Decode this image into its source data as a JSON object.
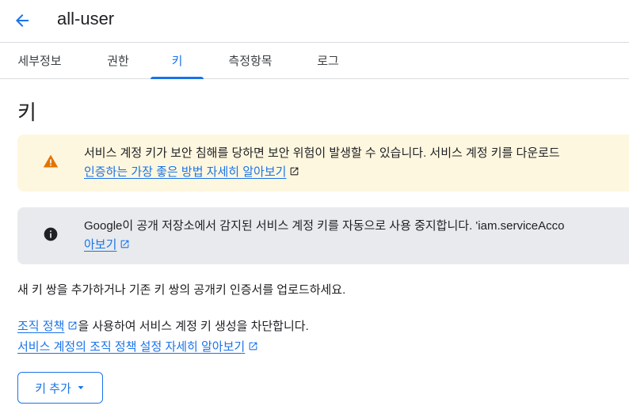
{
  "header": {
    "title": "all-user",
    "back_icon": "arrow-back-icon"
  },
  "tabs": [
    {
      "label": "세부정보",
      "active": false
    },
    {
      "label": "권한",
      "active": false
    },
    {
      "label": "키",
      "active": true
    },
    {
      "label": "측정항목",
      "active": false
    },
    {
      "label": "로그",
      "active": false
    }
  ],
  "section": {
    "title": "키"
  },
  "warning_banner": {
    "icon": "warning-icon",
    "text": "서비스 계정 키가 보안 침해를 당하면 보안 위험이 발생할 수 있습니다. 서비스 계정 키를 다운로드",
    "link": "인증하는 가장 좋은 방법 자세히 알아보기",
    "color": "#fef7e0",
    "icon_color": "#e37400"
  },
  "info_banner": {
    "icon": "info-icon",
    "text": "Google이 공개 저장소에서 감지된 서비스 계정 키를 자동으로 사용 중지합니다. 'iam.serviceAcco",
    "link": "아보기",
    "color": "#e8eaed"
  },
  "description": "새 키 쌍을 추가하거나 기존 키 쌍의 공개키 인증서를 업로드하세요.",
  "policy": {
    "link1": "조직 정책",
    "text1": "을 사용하여 서비스 계정 키 생성을 차단합니다.",
    "link2": "서비스 계정의 조직 정책 설정 자세히 알아보기"
  },
  "add_key_button": {
    "label": "키 추가",
    "icon": "caret-down-icon"
  },
  "colors": {
    "accent": "#1a73e8",
    "text": "#202124",
    "divider": "#dadce0"
  }
}
